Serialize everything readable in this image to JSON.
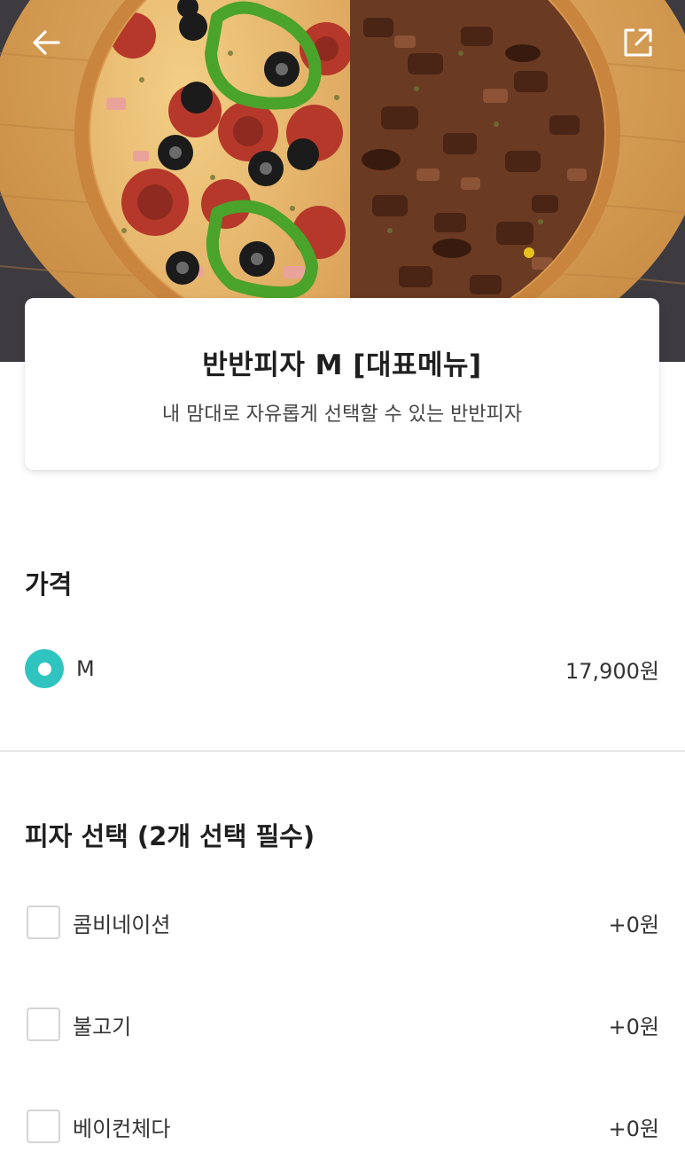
{
  "header": {
    "back_icon": "arrow-left-icon",
    "share_icon": "share-external-icon"
  },
  "menu": {
    "name": "반반피자 M [대표메뉴]",
    "description": "내 맘대로 자유롭게 선택할 수 있는 반반피자"
  },
  "price_section": {
    "title": "가격",
    "options": [
      {
        "label": "M",
        "price": "17,900원",
        "selected": true
      }
    ]
  },
  "pizza_section": {
    "title": "피자 선택 (2개 선택 필수)",
    "options": [
      {
        "label": "콤비네이션",
        "price": "+0원",
        "checked": false
      },
      {
        "label": "불고기",
        "price": "+0원",
        "checked": false
      },
      {
        "label": "베이컨체다",
        "price": "+0원",
        "checked": false
      }
    ]
  },
  "colors": {
    "accent": "#2fc4bf",
    "divider": "#e6e6e6",
    "checkbox_border": "#d4d4d4"
  }
}
